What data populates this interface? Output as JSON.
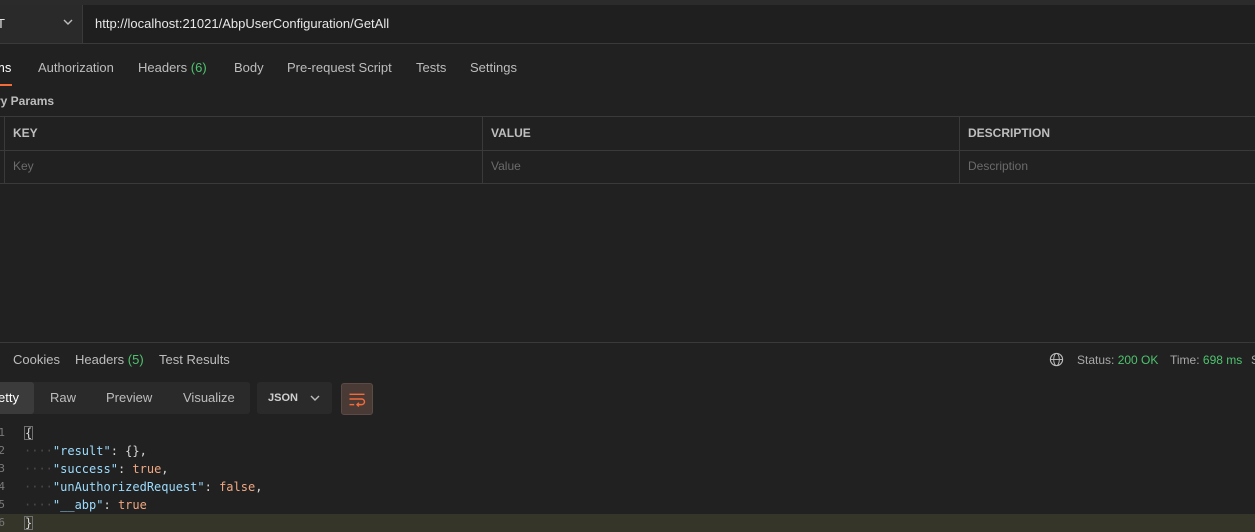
{
  "request": {
    "method": "T",
    "url": "http://localhost:21021/AbpUserConfiguration/GetAll"
  },
  "request_tabs": [
    {
      "label": "ms"
    },
    {
      "label": "Authorization"
    },
    {
      "label": "Headers",
      "count": "(6)"
    },
    {
      "label": "Body"
    },
    {
      "label": "Pre-request Script"
    },
    {
      "label": "Tests"
    },
    {
      "label": "Settings"
    }
  ],
  "query_params_title": "ry Params",
  "params_table": {
    "headers": [
      "KEY",
      "VALUE",
      "DESCRIPTION"
    ],
    "placeholders": [
      "Key",
      "Value",
      "Description"
    ]
  },
  "response_tabs": [
    {
      "label": "Cookies"
    },
    {
      "label": "Headers",
      "count": "(5)"
    },
    {
      "label": "Test Results"
    }
  ],
  "response_meta": {
    "status_label": "Status:",
    "status_value": "200 OK",
    "time_label": "Time:",
    "time_value": "698 ms",
    "cut": "S"
  },
  "view_modes": [
    "etty",
    "Raw",
    "Preview",
    "Visualize"
  ],
  "format": "JSON",
  "code": {
    "line_numbers": [
      "1",
      "2",
      "3",
      "4",
      "5",
      "6"
    ],
    "open_brace": "{",
    "close_brace": "}",
    "k_result": "\"result\"",
    "v_result": "{}",
    "k_success": "\"success\"",
    "v_success": "true",
    "k_unauth": "\"unAuthorizedRequest\"",
    "v_unauth": "false",
    "k_abp": "\"__abp\"",
    "v_abp": "true"
  },
  "icons": {
    "method_dropdown": "chevron-down-icon",
    "status_globe": "globe-icon",
    "format_dropdown": "chevron-down-icon",
    "wrap_lines": "wrap-lines-icon"
  },
  "colors": {
    "accent": "#f26b3a",
    "success": "#4ec36e",
    "json_key": "#9cdcfe",
    "json_literal": "#f0a883"
  }
}
